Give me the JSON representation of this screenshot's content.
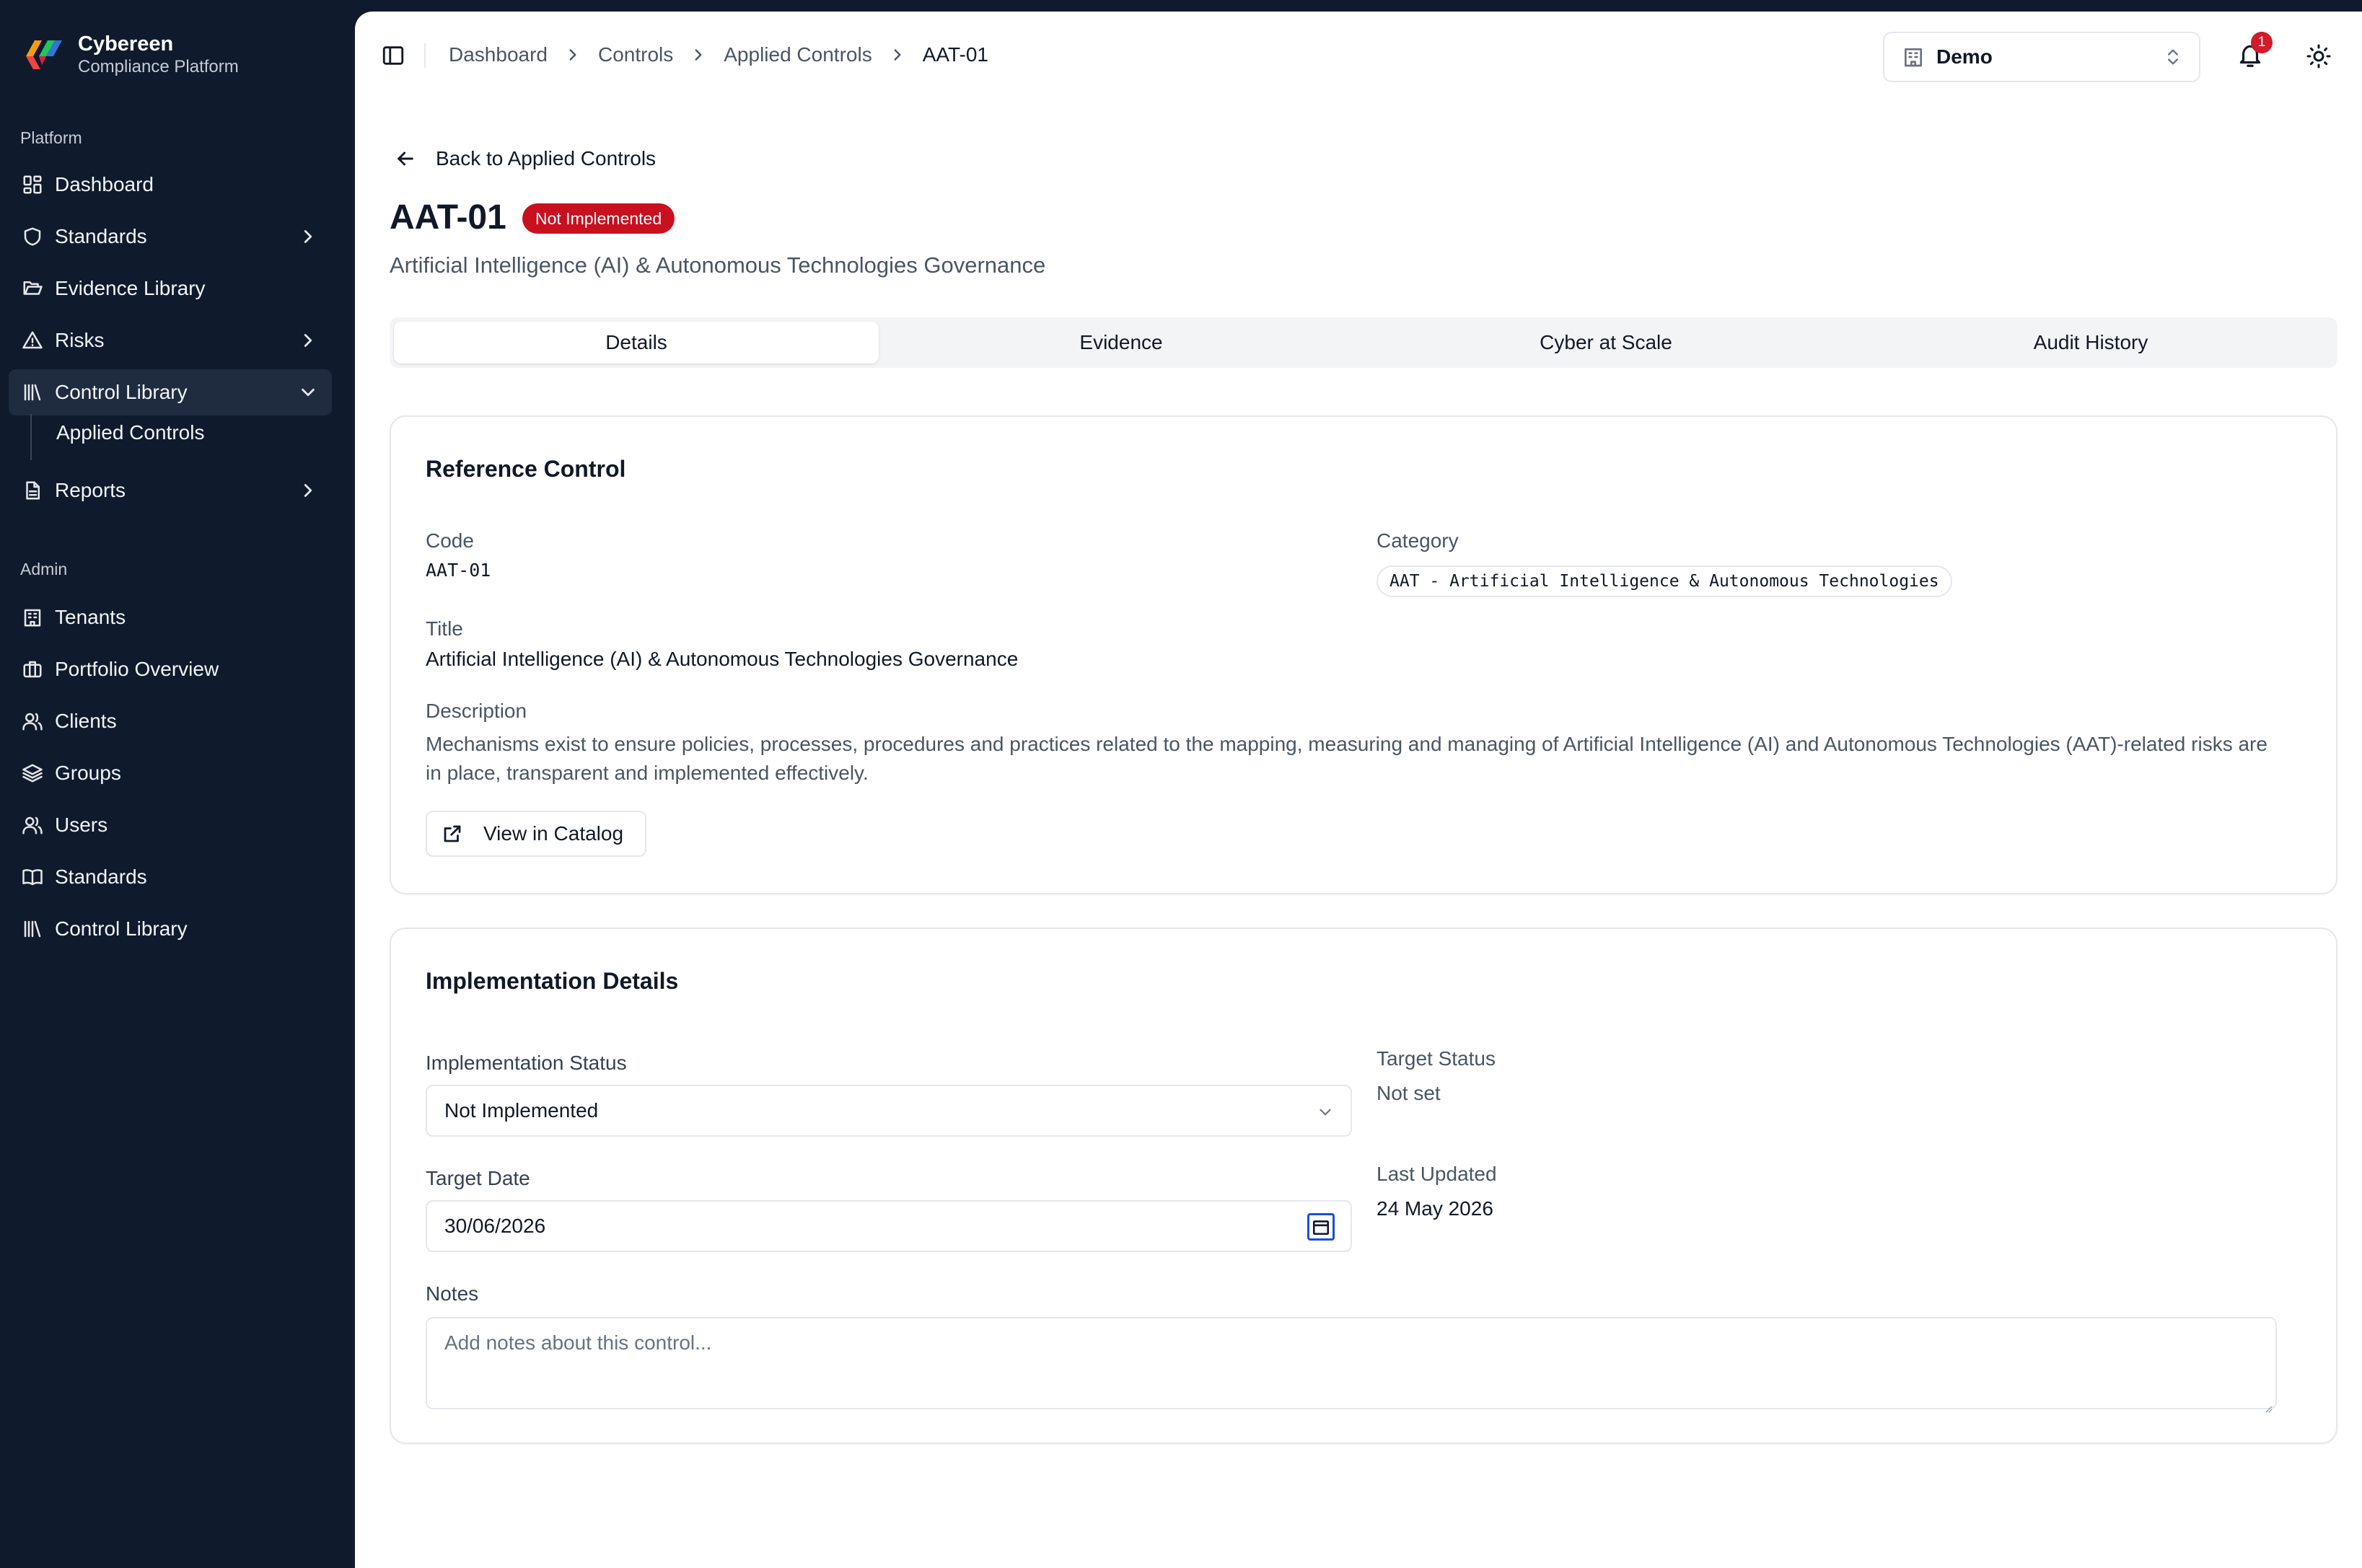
{
  "brand": {
    "name": "Cybereen",
    "subtitle": "Compliance Platform"
  },
  "sidebar": {
    "platform_label": "Platform",
    "admin_label": "Admin",
    "platform_items": [
      {
        "label": "Dashboard",
        "icon": "dashboard-icon"
      },
      {
        "label": "Standards",
        "icon": "shield-icon",
        "chevron": "right"
      },
      {
        "label": "Evidence Library",
        "icon": "folder-open-icon"
      },
      {
        "label": "Risks",
        "icon": "warning-triangle-icon",
        "chevron": "right"
      },
      {
        "label": "Control Library",
        "icon": "library-icon",
        "chevron": "down",
        "active": true
      },
      {
        "label": "Reports",
        "icon": "document-icon",
        "chevron": "right"
      }
    ],
    "sub_item": "Applied Controls",
    "admin_items": [
      {
        "label": "Tenants",
        "icon": "building-icon"
      },
      {
        "label": "Portfolio Overview",
        "icon": "briefcase-icon"
      },
      {
        "label": "Clients",
        "icon": "users-icon"
      },
      {
        "label": "Groups",
        "icon": "layers-icon"
      },
      {
        "label": "Users",
        "icon": "users-icon"
      },
      {
        "label": "Standards",
        "icon": "book-icon"
      },
      {
        "label": "Control Library",
        "icon": "library-icon"
      }
    ]
  },
  "topbar": {
    "breadcrumb": [
      "Dashboard",
      "Controls",
      "Applied Controls",
      "AAT-01"
    ],
    "tenant": "Demo",
    "notification_count": "1"
  },
  "page": {
    "back_label": "Back to Applied Controls",
    "title": "AAT-01",
    "status_badge": "Not Implemented",
    "subtitle": "Artificial Intelligence (AI) & Autonomous Technologies Governance"
  },
  "tabs": [
    "Details",
    "Evidence",
    "Cyber at Scale",
    "Audit History"
  ],
  "reference_control": {
    "heading": "Reference Control",
    "code_label": "Code",
    "code_value": "AAT-01",
    "category_label": "Category",
    "category_value": "AAT - Artificial Intelligence & Autonomous Technologies",
    "title_label": "Title",
    "title_value": "Artificial Intelligence (AI) & Autonomous Technologies Governance",
    "description_label": "Description",
    "description_value": "Mechanisms exist to ensure policies, processes, procedures and practices related to the mapping, measuring and managing of Artificial Intelligence (AI) and Autonomous Technologies (AAT)-related risks are in place, transparent and implemented effectively.",
    "catalog_button": "View in Catalog"
  },
  "implementation": {
    "heading": "Implementation Details",
    "status_label": "Implementation Status",
    "status_value": "Not Implemented",
    "target_status_label": "Target Status",
    "target_status_value": "Not set",
    "target_date_label": "Target Date",
    "target_date_value": "30/06/2026",
    "last_updated_label": "Last Updated",
    "last_updated_value": "24 May 2026",
    "notes_label": "Notes",
    "notes_placeholder": "Add notes about this control..."
  },
  "colors": {
    "sidebar_bg": "#0f1b2d",
    "badge_red": "#c8101e",
    "accent_blue": "#1d4ed8"
  }
}
